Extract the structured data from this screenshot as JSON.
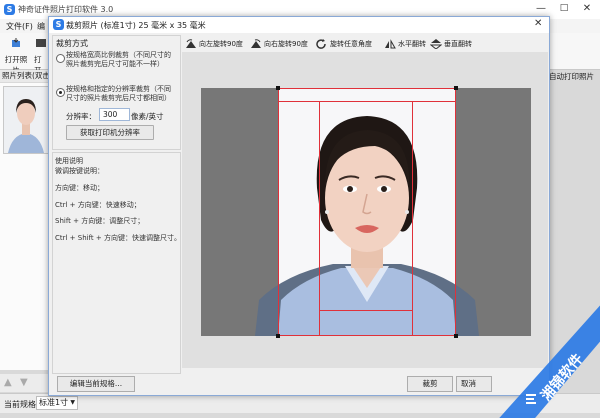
{
  "app": {
    "title": "神奇证件照片打印软件 3.0",
    "menu": [
      "文件(F)",
      "编"
    ],
    "toolbar": {
      "open_photo": "打开照片",
      "open_more": "打开"
    },
    "photolist_header": "照片列表(双击",
    "auto_print_label": "自动打印照片",
    "status": {
      "label": "当前规格:",
      "value": "标准1寸"
    },
    "window_controls": {
      "min": "—",
      "max": "□",
      "close": "✕"
    }
  },
  "dialog": {
    "title": "裁剪照片 (标准1寸) 25 毫米 x 35 毫米",
    "close": "✕",
    "crop_mode": {
      "title": "裁剪方式",
      "option1": "按规格宽高比例裁剪（不同尺寸的照片裁剪完后尺寸可能不一样）",
      "option1_line1": "按规格宽高比例裁剪（不同尺寸的",
      "option1_line2": "照片裁剪完后尺寸可能不一样）",
      "option2_line1": "按规格和指定的分辨率裁剪（不同",
      "option2_line2": "尺寸的照片裁剪完后尺寸都相同）",
      "selected": 2,
      "resolution_label": "分辨率：",
      "resolution_value": "300",
      "resolution_unit": "像素/英寸",
      "fetch_button": "获取打印机分辨率"
    },
    "help": {
      "title": "使用说明",
      "line1": "微调按键说明：",
      "line2": "方向键：移动；",
      "line3": "Ctrl + 方向键：快速移动；",
      "line4": "Shift + 方向键：调整尺寸；",
      "line5": "Ctrl + Shift + 方向键：快速调整尺寸。"
    },
    "tools": {
      "rotate_left": "向左旋转90度",
      "rotate_right": "向右旋转90度",
      "rotate_any": "旋转任意角度",
      "flip_h": "水平翻转",
      "flip_v": "垂直翻转"
    },
    "buttons": {
      "edit_spec": "编辑当前规格...",
      "crop": "裁剪",
      "cancel": "取消"
    }
  },
  "watermark": {
    "text": "湘锦软件"
  },
  "colors": {
    "accent": "#2d7be5",
    "crop_line": "#e0313a",
    "background_shirt": "#9fb6d9"
  }
}
